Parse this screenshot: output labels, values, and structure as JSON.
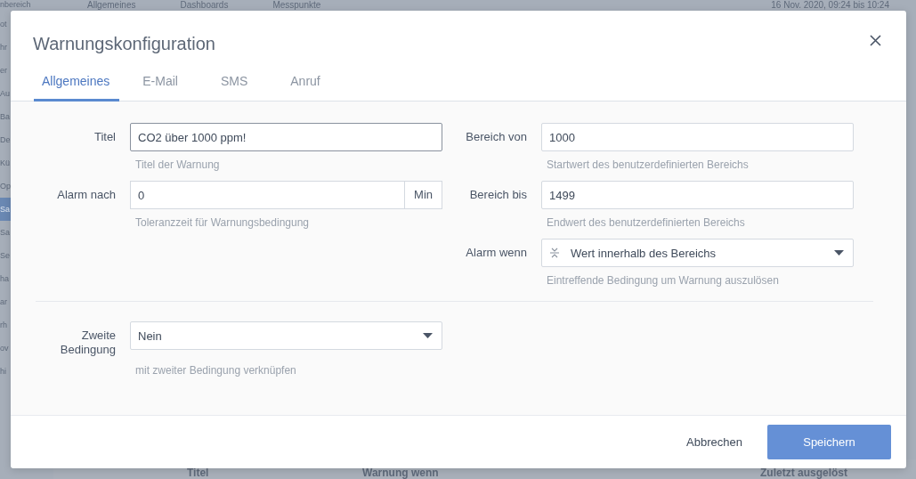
{
  "background": {
    "sidebar_items": [
      {
        "label": "nbereich",
        "selected": false
      },
      {
        "label": "ot",
        "selected": false
      },
      {
        "label": "hr",
        "selected": false
      },
      {
        "label": "er",
        "selected": false
      },
      {
        "label": "Au",
        "selected": false
      },
      {
        "label": "Ba",
        "selected": false
      },
      {
        "label": "De",
        "selected": false
      },
      {
        "label": "Kü",
        "selected": false
      },
      {
        "label": "Op",
        "selected": false
      },
      {
        "label": "Sa",
        "selected": true
      },
      {
        "label": "Sa",
        "selected": false
      },
      {
        "label": "Se",
        "selected": false
      },
      {
        "label": "ha",
        "selected": false
      },
      {
        "label": "ar",
        "selected": false
      },
      {
        "label": "rh",
        "selected": false
      },
      {
        "label": "ov",
        "selected": false
      },
      {
        "label": "hi",
        "selected": false
      }
    ],
    "top_tabs": [
      "Allgemeines",
      "Dashboards",
      "Messpunkte"
    ],
    "date_range": "16 Nov. 2020, 09:24 bis 10:24",
    "table_columns": [
      "Titel",
      "Warnung wenn",
      "Zuletzt ausgelöst"
    ]
  },
  "dialog": {
    "title": "Warnungskonfiguration",
    "tabs": [
      {
        "label": "Allgemeines",
        "selected": true
      },
      {
        "label": "E-Mail",
        "selected": false
      },
      {
        "label": "SMS",
        "selected": false
      },
      {
        "label": "Anruf",
        "selected": false
      }
    ],
    "left_fields": [
      {
        "kind": "text",
        "label": "Titel",
        "value": "CO2 über 1000 ppm!",
        "hint": "Titel der Warnung",
        "focused": true
      },
      {
        "kind": "unit",
        "label": "Alarm nach",
        "value": "0",
        "unit": "Min",
        "hint": "Toleranzzeit für Warnungsbedingung",
        "focused": false
      }
    ],
    "right_fields": [
      {
        "kind": "text",
        "label": "Bereich von",
        "value": "1000",
        "hint": "Startwert des benutzerdefinierten Bereichs",
        "focused": false
      },
      {
        "kind": "text",
        "label": "Bereich bis",
        "value": "1499",
        "hint": "Endwert des benutzerdefinierten Bereichs",
        "focused": false
      },
      {
        "kind": "select",
        "label": "Alarm wenn",
        "value": "Wert innerhalb des Bereichs",
        "icon": true,
        "hint": "Eintreffende Bedingung um Warnung auszulösen",
        "focused": false
      }
    ],
    "second_condition": {
      "kind": "select",
      "label": "Zweite Bedingung",
      "value": "Nein",
      "icon": false,
      "hint": "mit zweiter Bedingung verknüpfen",
      "focused": false
    },
    "buttons": [
      {
        "label": "Abbrechen",
        "kind": "secondary"
      },
      {
        "label": "Speichern",
        "kind": "primary"
      }
    ]
  }
}
